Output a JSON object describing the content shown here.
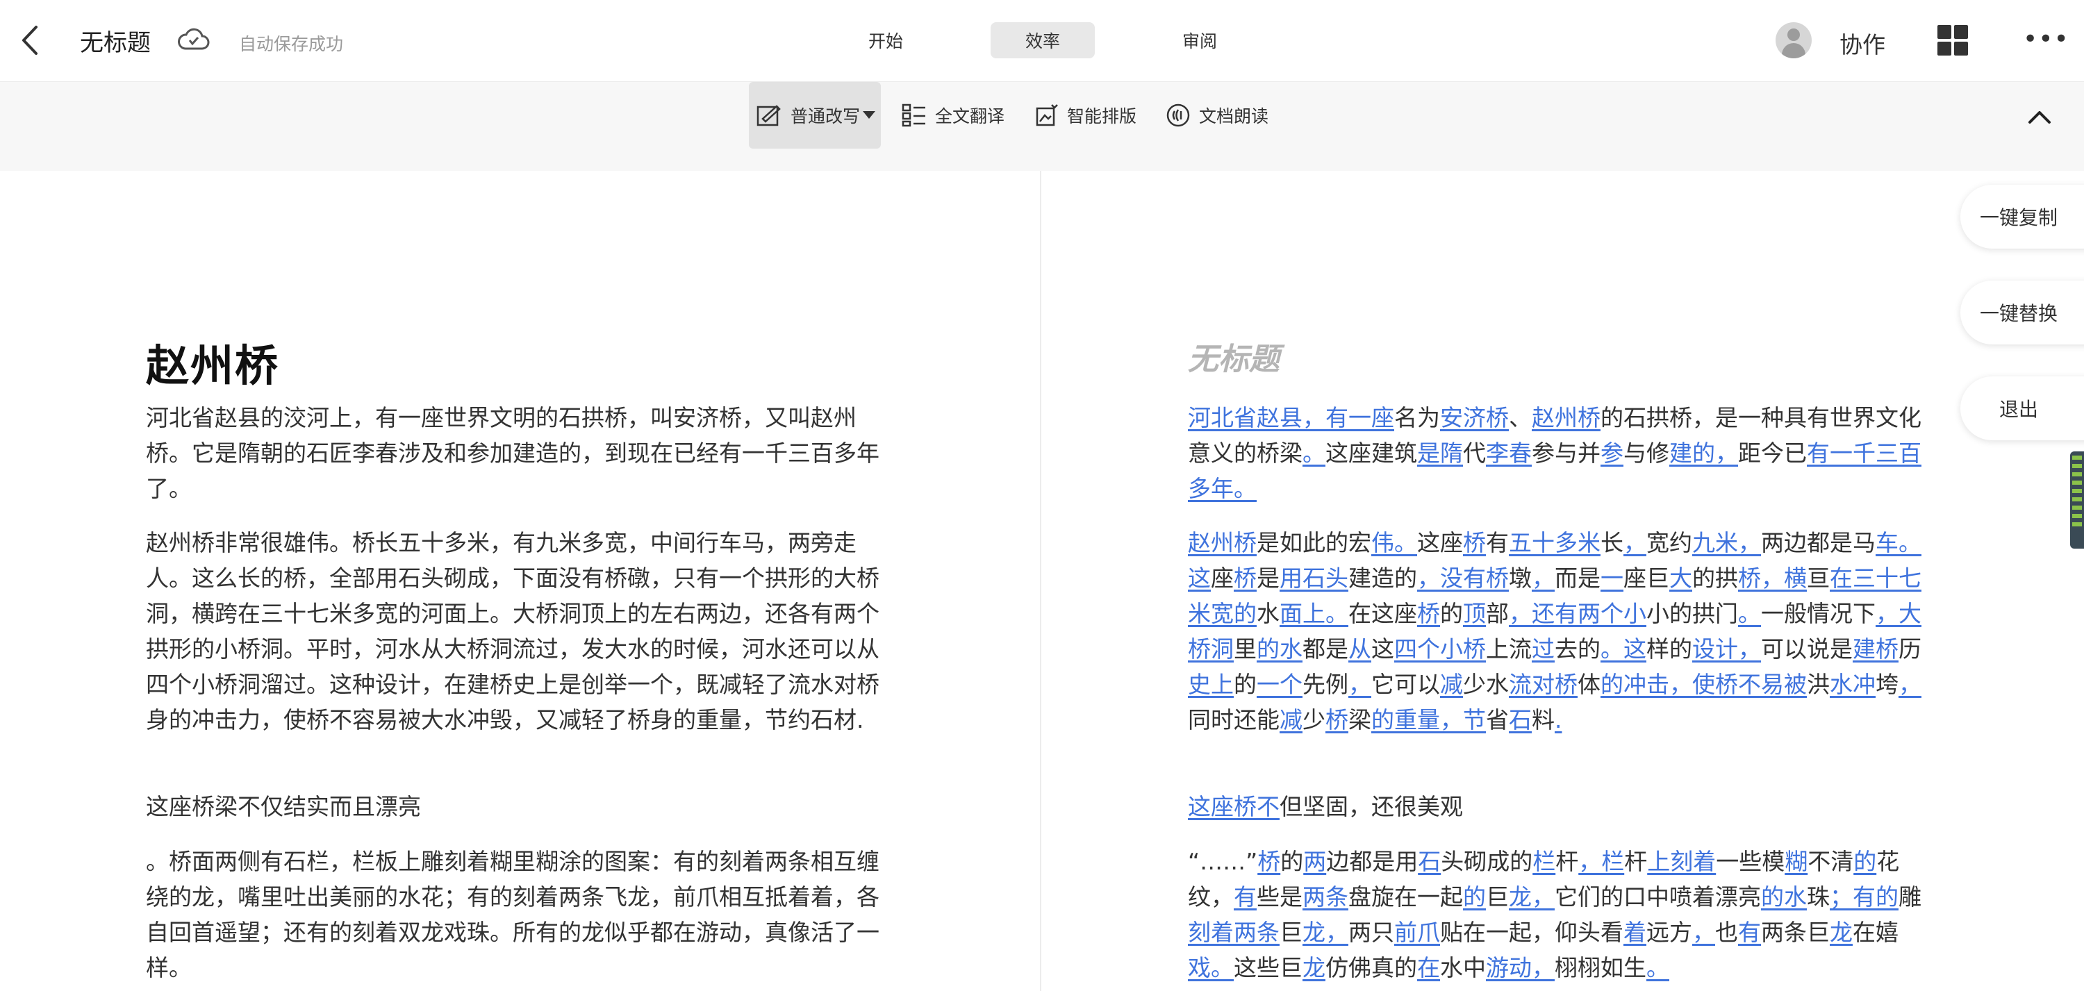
{
  "header": {
    "doc_title": "无标题",
    "save_status": "自动保存成功",
    "tabs": [
      {
        "label": "开始"
      },
      {
        "label": "效率"
      },
      {
        "label": "审阅"
      }
    ],
    "collab_label": "协作",
    "more_label": "•••"
  },
  "toolbar": {
    "items": [
      {
        "label": "普通改写"
      },
      {
        "label": "全文翻译"
      },
      {
        "label": "智能排版"
      },
      {
        "label": "文档朗读"
      }
    ]
  },
  "left_doc": {
    "title": "赵州桥",
    "paragraphs": [
      "河北省赵县的洨河上，有一座世界文明的石拱桥，叫安济桥，又叫赵州桥。它是隋朝的石匠李春涉及和参加建造的，到现在已经有一千三百多年了。",
      "赵州桥非常很雄伟。桥长五十多米，有九米多宽，中间行车马，两旁走人。这么长的桥，全部用石头砌成，下面没有桥礅，只有一个拱形的大桥洞，横跨在三十七米多宽的河面上。大桥洞顶上的左右两边，还各有两个拱形的小桥洞。平时，河水从大桥洞流过，发大水的时候，河水还可以从四个小桥洞溜过。这种设计，在建桥史上是创举一个，既减轻了流水对桥身的冲击力，使桥不容易被大水冲毁，又减轻了桥身的重量，节约石材.",
      "这座桥梁不仅结实而且漂亮",
      "。桥面两侧有石栏，栏板上雕刻着糊里糊涂的图案：有的刻着两条相互缠绕的龙，嘴里吐出美丽的水花；有的刻着两条飞龙，前爪相互抵着着，各自回首遥望；还有的刻着双龙戏珠。所有的龙似乎都在游动，真像活了一样。"
    ]
  },
  "right_doc": {
    "watermark": "无标题",
    "p1": [
      "河北省赵县，有一座",
      "名为",
      "安济桥",
      "、",
      "赵州桥",
      "的石拱桥，是一种具有世界文化意义的桥梁",
      "。",
      "这座建筑",
      "是隋",
      "代",
      "李春",
      "参与并",
      "参",
      "与修",
      "建的，",
      "距今已",
      "有一千三百多年。"
    ],
    "p2": [
      "赵州桥",
      "是如此的宏",
      "伟。",
      "这座",
      "桥",
      "有",
      "五十多米",
      "长",
      "，",
      "宽约",
      "九米，",
      "两边都是马",
      "车。这",
      "座",
      "桥",
      "是",
      "用石头",
      "建造的",
      "，没有桥",
      "墩",
      "，",
      "而是",
      "一",
      "座巨",
      "大",
      "的拱",
      "桥，横",
      "亘",
      "在三十七米宽的",
      "水",
      "面上。",
      "在这座",
      "桥",
      "的",
      "顶",
      "部",
      "，还有两个小",
      "小的拱门",
      "。",
      "一般情况下",
      "，大桥洞",
      "里",
      "的水",
      "都是",
      "从",
      "这",
      "四个小桥",
      "上流",
      "过",
      "去的",
      "。这",
      "样的",
      "设计，",
      "可以说是",
      "建桥",
      "历",
      "史上",
      "的",
      "一个",
      "先例",
      "，",
      "它可以",
      "减",
      "少水",
      "流对桥",
      "体",
      "的冲击，使桥不易被",
      "洪",
      "水冲",
      "垮",
      "，",
      "同时还能",
      "减",
      "少",
      "桥",
      "梁",
      "的重量，节",
      "省",
      "石",
      "料",
      "."
    ],
    "p3": [
      "这座桥不",
      "但坚固，还很美观"
    ],
    "p4": [
      "“……”",
      "桥",
      "的",
      "两",
      "边都是用",
      "石",
      "头砌成的",
      "栏",
      "杆",
      "，栏",
      "杆",
      "上刻着",
      "一些模",
      "糊",
      "不清",
      "的",
      "花纹，",
      "有",
      "些是",
      "两条",
      "盘旋在一起",
      "的",
      "巨",
      "龙，",
      "它们的口中喷着漂亮",
      "的水",
      "珠",
      "；有的",
      "雕",
      "刻着两条",
      "巨",
      "龙，",
      "两只",
      "前爪",
      "贴在一起，仰头看",
      "着",
      "远方",
      "，",
      "也",
      "有",
      "两条巨",
      "龙",
      "在嬉",
      "戏。",
      "这些巨",
      "龙",
      "仿佛真的",
      "在",
      "水中",
      "游动，",
      "栩栩如生",
      "。"
    ]
  },
  "side_buttons": [
    {
      "label": "一键复制"
    },
    {
      "label": "一键替换"
    },
    {
      "label": "退出"
    }
  ]
}
